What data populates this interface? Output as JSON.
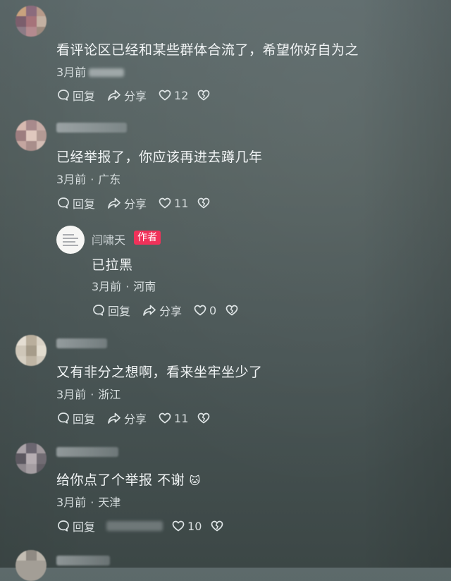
{
  "colors": {
    "background": "#556160",
    "author_badge": "#f0325a",
    "text_primary": "#f1f4f5",
    "text_secondary": "#d5dcdd"
  },
  "labels": {
    "reply": "回复",
    "share": "分享",
    "separator": "·"
  },
  "icons": {
    "reply": "reply-bubble-icon",
    "share": "share-arrow-icon",
    "like": "heart-icon",
    "dislike": "broken-heart-icon"
  },
  "comments": [
    {
      "text": "看评论区已经和某些群体合流了，希望你好自为之",
      "time": "3月前",
      "location": "",
      "likes": "12"
    },
    {
      "text": "已经举报了，你应该再进去蹲几年",
      "time": "3月前",
      "location": "广东",
      "likes": "11",
      "reply": {
        "name": "闫啸天",
        "badge": "作者",
        "text": "已拉黑",
        "time": "3月前",
        "location": "河南",
        "likes": "0"
      }
    },
    {
      "text": "又有非分之想啊，看来坐牢坐少了",
      "time": "3月前",
      "location": "浙江",
      "likes": "11"
    },
    {
      "text": "给你点了个举报 不谢",
      "emoji": "🐱",
      "time": "3月前",
      "location": "天津",
      "likes": "10"
    }
  ]
}
